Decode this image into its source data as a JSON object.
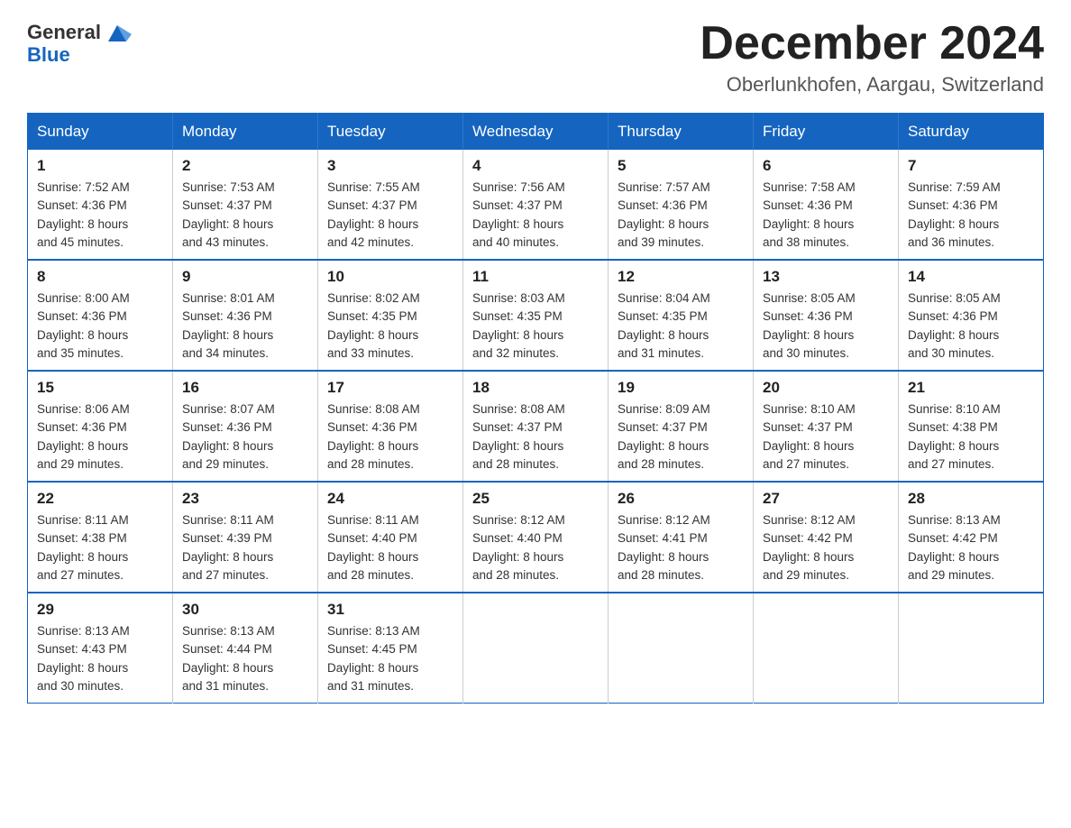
{
  "header": {
    "logo_general": "General",
    "logo_blue": "Blue",
    "month_title": "December 2024",
    "location": "Oberlunkhofen, Aargau, Switzerland"
  },
  "weekdays": [
    "Sunday",
    "Monday",
    "Tuesday",
    "Wednesday",
    "Thursday",
    "Friday",
    "Saturday"
  ],
  "weeks": [
    [
      {
        "day": "1",
        "sunrise": "7:52 AM",
        "sunset": "4:36 PM",
        "daylight": "8 hours and 45 minutes."
      },
      {
        "day": "2",
        "sunrise": "7:53 AM",
        "sunset": "4:37 PM",
        "daylight": "8 hours and 43 minutes."
      },
      {
        "day": "3",
        "sunrise": "7:55 AM",
        "sunset": "4:37 PM",
        "daylight": "8 hours and 42 minutes."
      },
      {
        "day": "4",
        "sunrise": "7:56 AM",
        "sunset": "4:37 PM",
        "daylight": "8 hours and 40 minutes."
      },
      {
        "day": "5",
        "sunrise": "7:57 AM",
        "sunset": "4:36 PM",
        "daylight": "8 hours and 39 minutes."
      },
      {
        "day": "6",
        "sunrise": "7:58 AM",
        "sunset": "4:36 PM",
        "daylight": "8 hours and 38 minutes."
      },
      {
        "day": "7",
        "sunrise": "7:59 AM",
        "sunset": "4:36 PM",
        "daylight": "8 hours and 36 minutes."
      }
    ],
    [
      {
        "day": "8",
        "sunrise": "8:00 AM",
        "sunset": "4:36 PM",
        "daylight": "8 hours and 35 minutes."
      },
      {
        "day": "9",
        "sunrise": "8:01 AM",
        "sunset": "4:36 PM",
        "daylight": "8 hours and 34 minutes."
      },
      {
        "day": "10",
        "sunrise": "8:02 AM",
        "sunset": "4:35 PM",
        "daylight": "8 hours and 33 minutes."
      },
      {
        "day": "11",
        "sunrise": "8:03 AM",
        "sunset": "4:35 PM",
        "daylight": "8 hours and 32 minutes."
      },
      {
        "day": "12",
        "sunrise": "8:04 AM",
        "sunset": "4:35 PM",
        "daylight": "8 hours and 31 minutes."
      },
      {
        "day": "13",
        "sunrise": "8:05 AM",
        "sunset": "4:36 PM",
        "daylight": "8 hours and 30 minutes."
      },
      {
        "day": "14",
        "sunrise": "8:05 AM",
        "sunset": "4:36 PM",
        "daylight": "8 hours and 30 minutes."
      }
    ],
    [
      {
        "day": "15",
        "sunrise": "8:06 AM",
        "sunset": "4:36 PM",
        "daylight": "8 hours and 29 minutes."
      },
      {
        "day": "16",
        "sunrise": "8:07 AM",
        "sunset": "4:36 PM",
        "daylight": "8 hours and 29 minutes."
      },
      {
        "day": "17",
        "sunrise": "8:08 AM",
        "sunset": "4:36 PM",
        "daylight": "8 hours and 28 minutes."
      },
      {
        "day": "18",
        "sunrise": "8:08 AM",
        "sunset": "4:37 PM",
        "daylight": "8 hours and 28 minutes."
      },
      {
        "day": "19",
        "sunrise": "8:09 AM",
        "sunset": "4:37 PM",
        "daylight": "8 hours and 28 minutes."
      },
      {
        "day": "20",
        "sunrise": "8:10 AM",
        "sunset": "4:37 PM",
        "daylight": "8 hours and 27 minutes."
      },
      {
        "day": "21",
        "sunrise": "8:10 AM",
        "sunset": "4:38 PM",
        "daylight": "8 hours and 27 minutes."
      }
    ],
    [
      {
        "day": "22",
        "sunrise": "8:11 AM",
        "sunset": "4:38 PM",
        "daylight": "8 hours and 27 minutes."
      },
      {
        "day": "23",
        "sunrise": "8:11 AM",
        "sunset": "4:39 PM",
        "daylight": "8 hours and 27 minutes."
      },
      {
        "day": "24",
        "sunrise": "8:11 AM",
        "sunset": "4:40 PM",
        "daylight": "8 hours and 28 minutes."
      },
      {
        "day": "25",
        "sunrise": "8:12 AM",
        "sunset": "4:40 PM",
        "daylight": "8 hours and 28 minutes."
      },
      {
        "day": "26",
        "sunrise": "8:12 AM",
        "sunset": "4:41 PM",
        "daylight": "8 hours and 28 minutes."
      },
      {
        "day": "27",
        "sunrise": "8:12 AM",
        "sunset": "4:42 PM",
        "daylight": "8 hours and 29 minutes."
      },
      {
        "day": "28",
        "sunrise": "8:13 AM",
        "sunset": "4:42 PM",
        "daylight": "8 hours and 29 minutes."
      }
    ],
    [
      {
        "day": "29",
        "sunrise": "8:13 AM",
        "sunset": "4:43 PM",
        "daylight": "8 hours and 30 minutes."
      },
      {
        "day": "30",
        "sunrise": "8:13 AM",
        "sunset": "4:44 PM",
        "daylight": "8 hours and 31 minutes."
      },
      {
        "day": "31",
        "sunrise": "8:13 AM",
        "sunset": "4:45 PM",
        "daylight": "8 hours and 31 minutes."
      },
      null,
      null,
      null,
      null
    ]
  ],
  "labels": {
    "sunrise": "Sunrise:",
    "sunset": "Sunset:",
    "daylight": "Daylight:"
  }
}
